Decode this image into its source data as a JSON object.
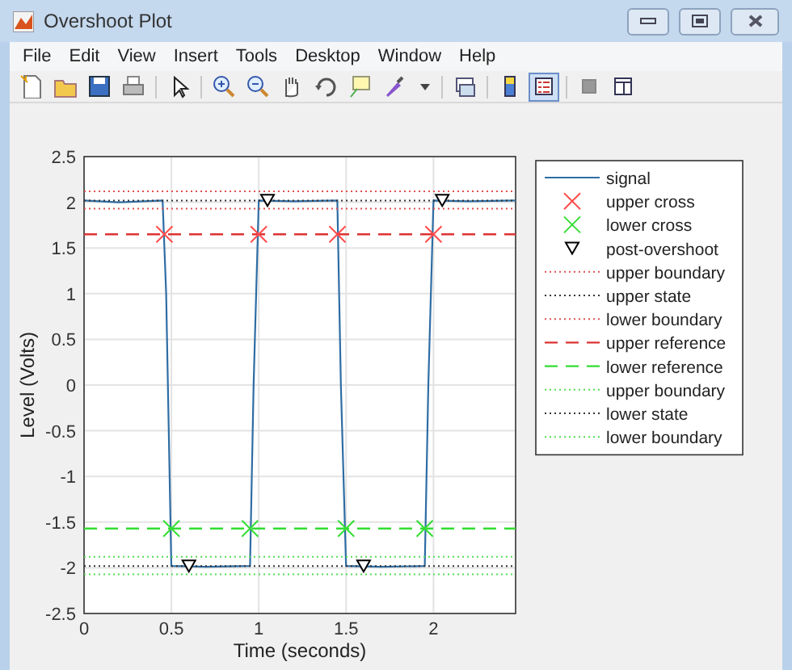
{
  "window": {
    "title": "Overshoot Plot"
  },
  "menu": [
    "File",
    "Edit",
    "View",
    "Insert",
    "Tools",
    "Desktop",
    "Window",
    "Help"
  ],
  "toolbar": [
    {
      "kind": "new",
      "selected": false
    },
    {
      "kind": "open",
      "selected": false
    },
    {
      "kind": "save",
      "selected": false
    },
    {
      "kind": "print",
      "selected": false
    },
    {
      "kind": "sep"
    },
    {
      "kind": "pointer",
      "selected": false
    },
    {
      "kind": "sep"
    },
    {
      "kind": "zoomin",
      "selected": false
    },
    {
      "kind": "zoomout",
      "selected": false
    },
    {
      "kind": "pan",
      "selected": false
    },
    {
      "kind": "rotate",
      "selected": false
    },
    {
      "kind": "cursor",
      "selected": false
    },
    {
      "kind": "brush",
      "selected": false
    },
    {
      "kind": "caret"
    },
    {
      "kind": "sep"
    },
    {
      "kind": "link",
      "selected": false
    },
    {
      "kind": "sep"
    },
    {
      "kind": "colorbar",
      "selected": false
    },
    {
      "kind": "legend",
      "selected": true
    },
    {
      "kind": "sep"
    },
    {
      "kind": "square",
      "selected": false
    },
    {
      "kind": "panel",
      "selected": false
    }
  ],
  "chart_data": {
    "type": "line",
    "xlabel": "Time (seconds)",
    "ylabel": "Level (Volts)",
    "xlim": [
      0,
      2.47
    ],
    "ylim": [
      -2.5,
      2.5
    ],
    "grid": true,
    "legend": true,
    "xticks": [
      0,
      0.5,
      1,
      1.5,
      2
    ],
    "yticks": [
      -2.5,
      -2,
      -1.5,
      -1,
      -0.5,
      0,
      0.5,
      1,
      1.5,
      2,
      2.5
    ],
    "series": [
      {
        "name": "signal",
        "color": "#2e6da4",
        "type": "line",
        "x": [
          0,
          0.2,
          0.45,
          0.47,
          0.5,
          0.7,
          0.95,
          0.97,
          1.0,
          1.2,
          1.45,
          1.47,
          1.5,
          1.7,
          1.95,
          1.97,
          2.0,
          2.2,
          2.47
        ],
        "values": [
          2.02,
          2.0,
          2.02,
          1.0,
          -1.98,
          -1.99,
          -1.98,
          0,
          2.02,
          2.01,
          2.02,
          0,
          -1.98,
          -1.99,
          -1.98,
          0,
          2.02,
          2.01,
          2.02
        ]
      },
      {
        "name": "upper cross",
        "color": "#ff4b4b",
        "type": "scatter",
        "marker": "x",
        "x": [
          0.46,
          1.0,
          1.45,
          2.0
        ],
        "values": [
          1.65,
          1.65,
          1.65,
          1.65
        ]
      },
      {
        "name": "lower cross",
        "color": "#33dd33",
        "type": "scatter",
        "marker": "x",
        "x": [
          0.5,
          0.95,
          1.5,
          1.95
        ],
        "values": [
          -1.57,
          -1.57,
          -1.57,
          -1.57
        ]
      },
      {
        "name": "post-overshoot",
        "color": "#000000",
        "type": "scatter",
        "marker": "v",
        "x": [
          0.6,
          1.05,
          1.6,
          2.05
        ],
        "values": [
          -1.98,
          2.02,
          -1.98,
          2.02
        ]
      },
      {
        "name": "upper boundary",
        "color": "#e05050",
        "type": "line",
        "line_style": "dotted",
        "x": [
          0,
          2.47
        ],
        "values": [
          2.12,
          2.12
        ]
      },
      {
        "name": "upper state",
        "color": "#333333",
        "type": "line",
        "line_style": "dotted",
        "x": [
          0,
          2.47
        ],
        "values": [
          2.02,
          2.02
        ]
      },
      {
        "name": "lower boundary",
        "color": "#e05050",
        "type": "line",
        "line_style": "dotted",
        "x": [
          0,
          2.47
        ],
        "values": [
          1.93,
          1.93
        ]
      },
      {
        "name": "upper reference",
        "color": "#dd3333",
        "type": "line",
        "line_style": "dashed",
        "x": [
          0,
          2.47
        ],
        "values": [
          1.65,
          1.65
        ]
      },
      {
        "name": "lower reference",
        "color": "#33dd33",
        "type": "line",
        "line_style": "dashed",
        "x": [
          0,
          2.47
        ],
        "values": [
          -1.57,
          -1.57
        ]
      },
      {
        "name": "upper boundary",
        "color": "#55dd55",
        "type": "line",
        "line_style": "dotted",
        "x": [
          0,
          2.47
        ],
        "values": [
          -1.88,
          -1.88
        ]
      },
      {
        "name": "lower state",
        "color": "#333333",
        "type": "line",
        "line_style": "dotted",
        "x": [
          0,
          2.47
        ],
        "values": [
          -1.98,
          -1.98
        ]
      },
      {
        "name": "lower boundary",
        "color": "#55dd55",
        "type": "line",
        "line_style": "dotted",
        "x": [
          0,
          2.47
        ],
        "values": [
          -2.07,
          -2.07
        ]
      }
    ]
  }
}
